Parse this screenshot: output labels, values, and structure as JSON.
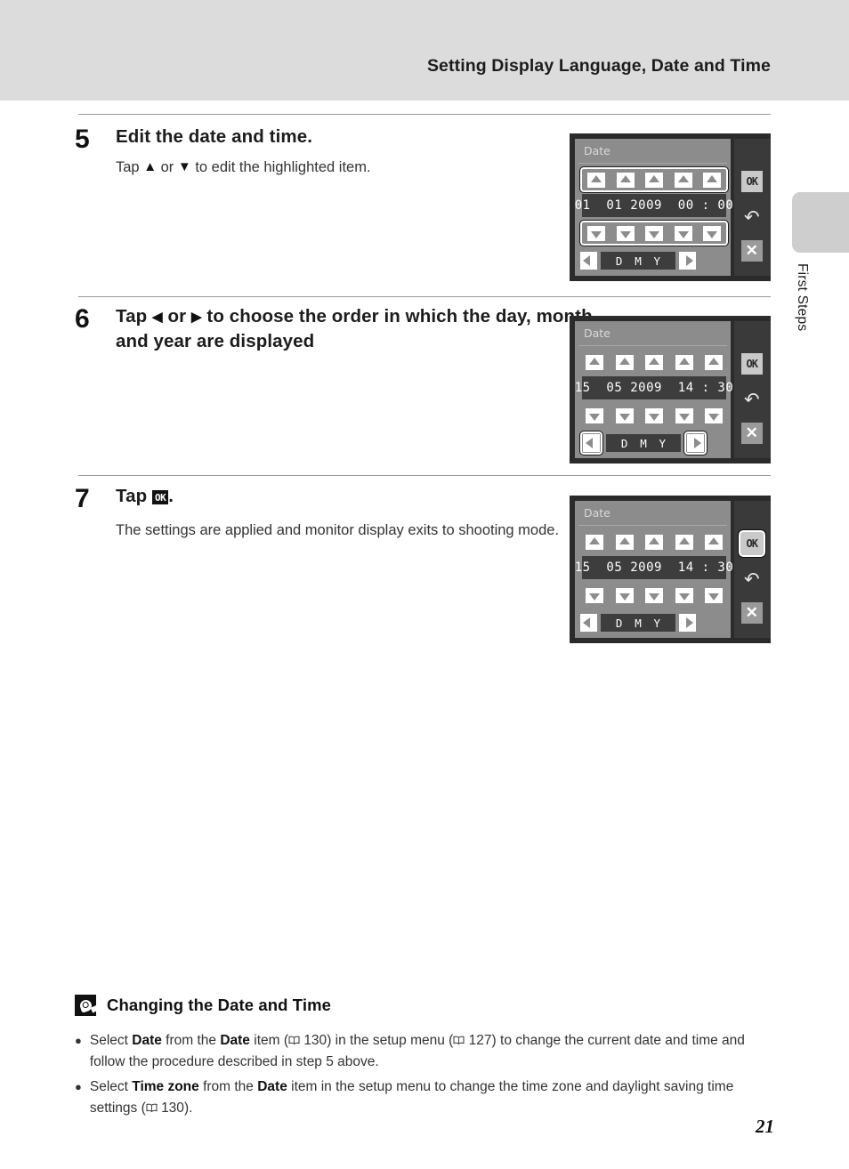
{
  "header": {
    "title": "Setting Display Language, Date and Time"
  },
  "thumb_tab": {
    "label": "First Steps"
  },
  "steps": [
    {
      "number": "5",
      "heading_before": "Edit the date and time.",
      "sub_before": "Tap ",
      "sub_mid": " or ",
      "sub_after": " to edit the highlighted item."
    },
    {
      "number": "6",
      "head_a": "Tap ",
      "head_b": " or ",
      "head_c": " to choose the order in which the day, month and year are displayed"
    },
    {
      "number": "7",
      "head_a": "Tap ",
      "ok_label": "OK",
      "head_c": ".",
      "sub": "The settings are applied and monitor display exits to shooting mode."
    }
  ],
  "screens": [
    {
      "title": "Date",
      "date_value": "01  01 2009  00 : 00",
      "order_labels": [
        "D",
        "M",
        "Y"
      ],
      "ok_label": "OK",
      "back_glyph": "↶",
      "close_glyph": "✕",
      "highlight": "arrows"
    },
    {
      "title": "Date",
      "date_value": "15  05 2009  14 : 30",
      "order_labels": [
        "D",
        "M",
        "Y"
      ],
      "ok_label": "OK",
      "back_glyph": "↶",
      "close_glyph": "✕",
      "highlight": "leftright"
    },
    {
      "title": "Date",
      "date_value": "15  05 2009  14 : 30",
      "order_labels": [
        "D",
        "M",
        "Y"
      ],
      "ok_label": "OK",
      "back_glyph": "↶",
      "close_glyph": "✕",
      "highlight": "ok"
    }
  ],
  "note": {
    "title": "Changing the Date and Time",
    "bullets": [
      {
        "p1": "Select ",
        "b1": "Date",
        "p2": " from the ",
        "b2": "Date",
        "p3": " item (",
        "ref1": "130",
        "p4": ") in the setup menu (",
        "ref2": "127",
        "p5": ") to change the current date and time and follow the procedure described in step 5 above."
      },
      {
        "p1": "Select ",
        "b1": "Time zone",
        "p2": " from the ",
        "b2": "Date",
        "p3": " item in the setup menu to change the time zone and daylight saving time settings (",
        "ref1": "130",
        "p4": ")."
      }
    ]
  },
  "page_number": "21",
  "colors": {
    "header_band": "#dcdcdc",
    "screen_frame": "#2b2b2b",
    "screen_body": "#8c8c8c",
    "screen_side": "#3a3a3a",
    "value_strip": "#3d3d3d"
  }
}
